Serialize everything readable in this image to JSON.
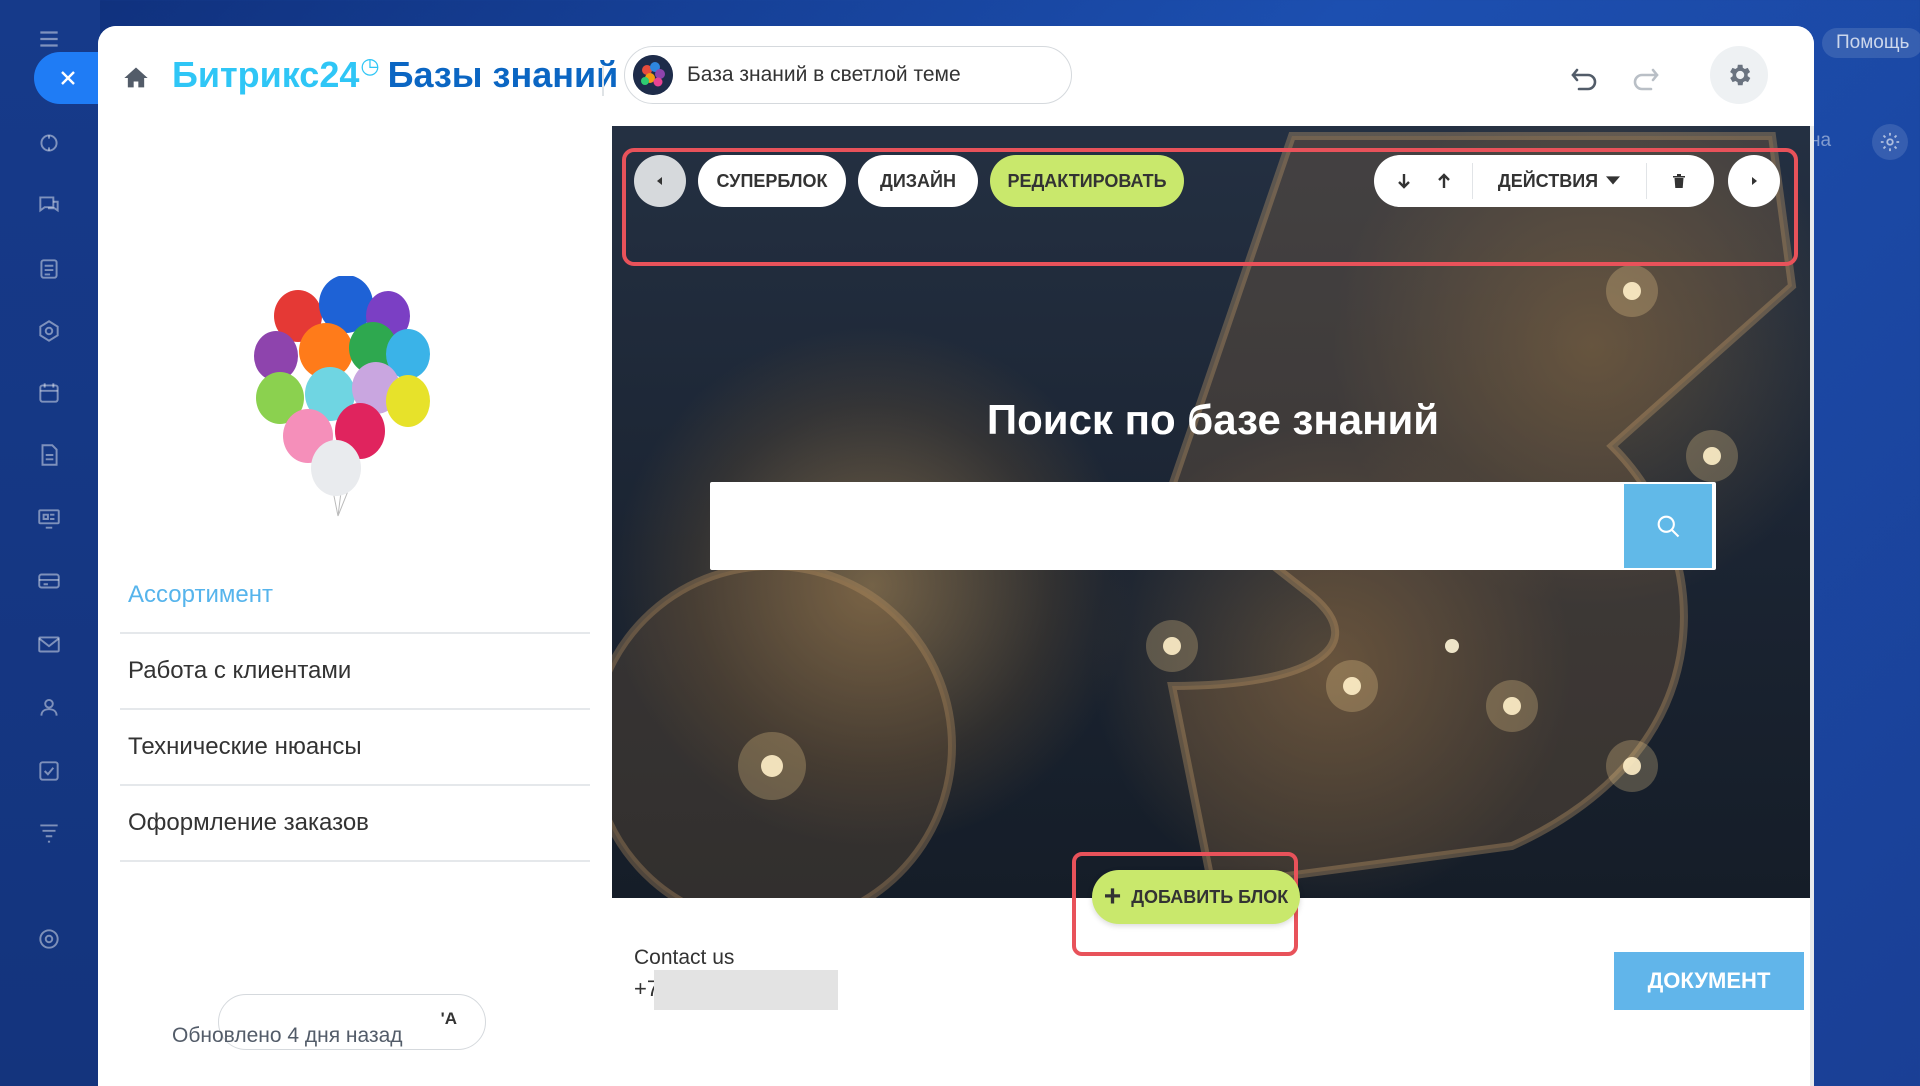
{
  "background": {
    "help_label": "Помощь",
    "partial_label": "на"
  },
  "topbar": {
    "brand_main": "Битрикс24",
    "brand_clock": "◷",
    "brand_section": "Базы знаний",
    "site_label": "База знаний в светлой теме"
  },
  "sidebar": {
    "menu_items": [
      {
        "label": "Ассортимент",
        "active": true
      },
      {
        "label": "Работа с клиентами",
        "active": false
      },
      {
        "label": "Технические нюансы",
        "active": false
      },
      {
        "label": "Оформление заказов",
        "active": false
      }
    ],
    "pill_tail_text": "'А",
    "updated_label": "Обновлено 4 дня назад"
  },
  "toolbar": {
    "superblock_label": "Суперблок",
    "design_label": "Дизайн",
    "edit_label": "Редактировать",
    "actions_label": "Действия"
  },
  "hero": {
    "title": "Поиск по базе знаний",
    "search_value": ""
  },
  "footer": {
    "contact_title": "Contact us",
    "phone_prefix": "+7",
    "document_label": "ДОКУМЕНТ"
  },
  "add_block": {
    "label": "Добавить блок"
  },
  "colors": {
    "accent_green": "#c9e86c",
    "highlight_red": "#e8525a",
    "brand_light_blue": "#2fc6f6",
    "brand_dark_blue": "#0b66c3",
    "search_button": "#61b9e8"
  }
}
